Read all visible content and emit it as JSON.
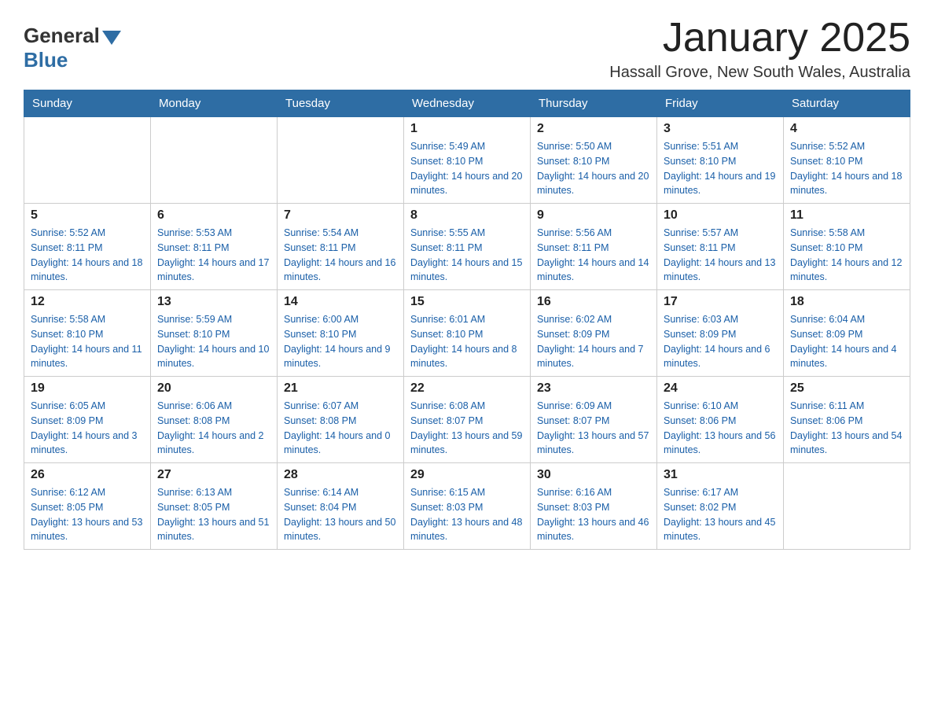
{
  "logo": {
    "general": "General",
    "blue": "Blue"
  },
  "header": {
    "month_year": "January 2025",
    "location": "Hassall Grove, New South Wales, Australia"
  },
  "days_of_week": [
    "Sunday",
    "Monday",
    "Tuesday",
    "Wednesday",
    "Thursday",
    "Friday",
    "Saturday"
  ],
  "weeks": [
    [
      {
        "day": "",
        "info": ""
      },
      {
        "day": "",
        "info": ""
      },
      {
        "day": "",
        "info": ""
      },
      {
        "day": "1",
        "info": "Sunrise: 5:49 AM\nSunset: 8:10 PM\nDaylight: 14 hours and 20 minutes."
      },
      {
        "day": "2",
        "info": "Sunrise: 5:50 AM\nSunset: 8:10 PM\nDaylight: 14 hours and 20 minutes."
      },
      {
        "day": "3",
        "info": "Sunrise: 5:51 AM\nSunset: 8:10 PM\nDaylight: 14 hours and 19 minutes."
      },
      {
        "day": "4",
        "info": "Sunrise: 5:52 AM\nSunset: 8:10 PM\nDaylight: 14 hours and 18 minutes."
      }
    ],
    [
      {
        "day": "5",
        "info": "Sunrise: 5:52 AM\nSunset: 8:11 PM\nDaylight: 14 hours and 18 minutes."
      },
      {
        "day": "6",
        "info": "Sunrise: 5:53 AM\nSunset: 8:11 PM\nDaylight: 14 hours and 17 minutes."
      },
      {
        "day": "7",
        "info": "Sunrise: 5:54 AM\nSunset: 8:11 PM\nDaylight: 14 hours and 16 minutes."
      },
      {
        "day": "8",
        "info": "Sunrise: 5:55 AM\nSunset: 8:11 PM\nDaylight: 14 hours and 15 minutes."
      },
      {
        "day": "9",
        "info": "Sunrise: 5:56 AM\nSunset: 8:11 PM\nDaylight: 14 hours and 14 minutes."
      },
      {
        "day": "10",
        "info": "Sunrise: 5:57 AM\nSunset: 8:11 PM\nDaylight: 14 hours and 13 minutes."
      },
      {
        "day": "11",
        "info": "Sunrise: 5:58 AM\nSunset: 8:10 PM\nDaylight: 14 hours and 12 minutes."
      }
    ],
    [
      {
        "day": "12",
        "info": "Sunrise: 5:58 AM\nSunset: 8:10 PM\nDaylight: 14 hours and 11 minutes."
      },
      {
        "day": "13",
        "info": "Sunrise: 5:59 AM\nSunset: 8:10 PM\nDaylight: 14 hours and 10 minutes."
      },
      {
        "day": "14",
        "info": "Sunrise: 6:00 AM\nSunset: 8:10 PM\nDaylight: 14 hours and 9 minutes."
      },
      {
        "day": "15",
        "info": "Sunrise: 6:01 AM\nSunset: 8:10 PM\nDaylight: 14 hours and 8 minutes."
      },
      {
        "day": "16",
        "info": "Sunrise: 6:02 AM\nSunset: 8:09 PM\nDaylight: 14 hours and 7 minutes."
      },
      {
        "day": "17",
        "info": "Sunrise: 6:03 AM\nSunset: 8:09 PM\nDaylight: 14 hours and 6 minutes."
      },
      {
        "day": "18",
        "info": "Sunrise: 6:04 AM\nSunset: 8:09 PM\nDaylight: 14 hours and 4 minutes."
      }
    ],
    [
      {
        "day": "19",
        "info": "Sunrise: 6:05 AM\nSunset: 8:09 PM\nDaylight: 14 hours and 3 minutes."
      },
      {
        "day": "20",
        "info": "Sunrise: 6:06 AM\nSunset: 8:08 PM\nDaylight: 14 hours and 2 minutes."
      },
      {
        "day": "21",
        "info": "Sunrise: 6:07 AM\nSunset: 8:08 PM\nDaylight: 14 hours and 0 minutes."
      },
      {
        "day": "22",
        "info": "Sunrise: 6:08 AM\nSunset: 8:07 PM\nDaylight: 13 hours and 59 minutes."
      },
      {
        "day": "23",
        "info": "Sunrise: 6:09 AM\nSunset: 8:07 PM\nDaylight: 13 hours and 57 minutes."
      },
      {
        "day": "24",
        "info": "Sunrise: 6:10 AM\nSunset: 8:06 PM\nDaylight: 13 hours and 56 minutes."
      },
      {
        "day": "25",
        "info": "Sunrise: 6:11 AM\nSunset: 8:06 PM\nDaylight: 13 hours and 54 minutes."
      }
    ],
    [
      {
        "day": "26",
        "info": "Sunrise: 6:12 AM\nSunset: 8:05 PM\nDaylight: 13 hours and 53 minutes."
      },
      {
        "day": "27",
        "info": "Sunrise: 6:13 AM\nSunset: 8:05 PM\nDaylight: 13 hours and 51 minutes."
      },
      {
        "day": "28",
        "info": "Sunrise: 6:14 AM\nSunset: 8:04 PM\nDaylight: 13 hours and 50 minutes."
      },
      {
        "day": "29",
        "info": "Sunrise: 6:15 AM\nSunset: 8:03 PM\nDaylight: 13 hours and 48 minutes."
      },
      {
        "day": "30",
        "info": "Sunrise: 6:16 AM\nSunset: 8:03 PM\nDaylight: 13 hours and 46 minutes."
      },
      {
        "day": "31",
        "info": "Sunrise: 6:17 AM\nSunset: 8:02 PM\nDaylight: 13 hours and 45 minutes."
      },
      {
        "day": "",
        "info": ""
      }
    ]
  ]
}
